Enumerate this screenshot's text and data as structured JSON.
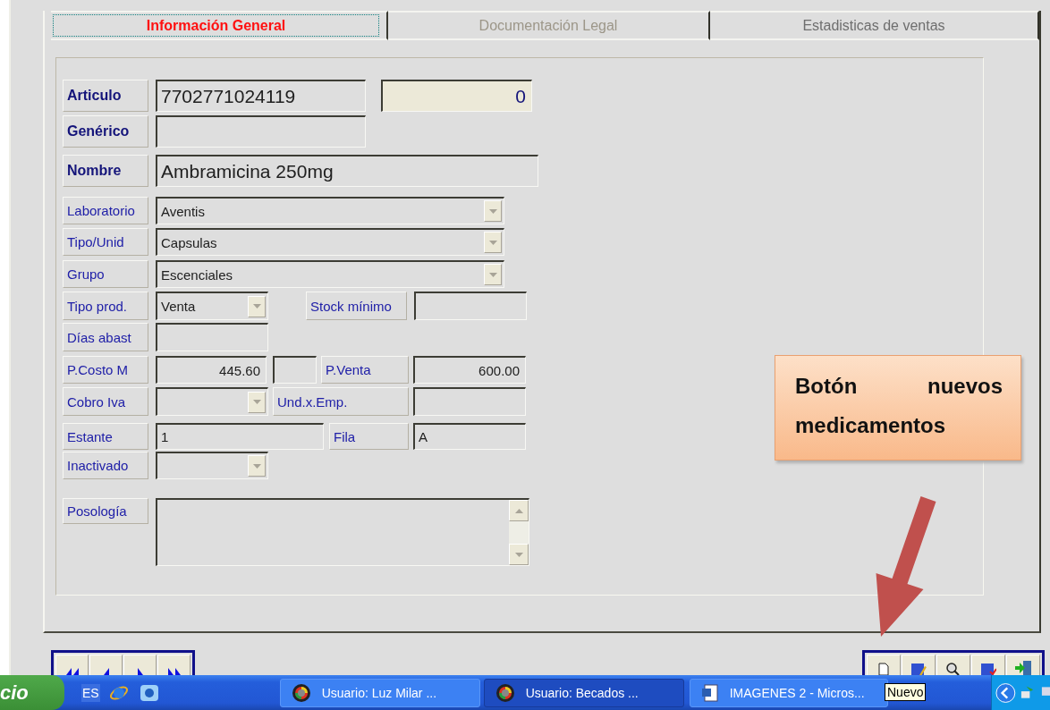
{
  "tabs": [
    {
      "label": "Información General",
      "selected": true,
      "disabled": false
    },
    {
      "label": "Documentación Legal",
      "selected": false,
      "disabled": true
    },
    {
      "label": "Estadisticas de ventas",
      "selected": false,
      "disabled": false
    }
  ],
  "form": {
    "articulo": {
      "label": "Articulo",
      "value": "7702771024119",
      "counter": "0"
    },
    "generico": {
      "label": "Genérico"
    },
    "nombre": {
      "label": "Nombre",
      "value": "Ambramicina 250mg"
    },
    "laboratorio": {
      "label": "Laboratorio",
      "value": "Aventis"
    },
    "tipo_unid": {
      "label": "Tipo/Unid",
      "value": "Capsulas"
    },
    "grupo": {
      "label": "Grupo",
      "value": "Escenciales"
    },
    "tipo_prod": {
      "label": "Tipo prod.",
      "value": "Venta"
    },
    "stock_minimo": {
      "label": "Stock mínimo"
    },
    "dias_abast": {
      "label": "Días abast"
    },
    "p_costo": {
      "label": "P.Costo M",
      "value": "445.60"
    },
    "p_venta": {
      "label": "P.Venta",
      "value": "600.00"
    },
    "cobro_iva": {
      "label": "Cobro Iva"
    },
    "und_emp": {
      "label": "Und.x.Emp."
    },
    "estante": {
      "label": "Estante",
      "value": "1"
    },
    "fila": {
      "label": "Fila",
      "value": "A"
    },
    "inactivado": {
      "label": "Inactivado"
    },
    "posologia": {
      "label": "Posología"
    }
  },
  "callout": {
    "text": "Botón nuevos medicamentos"
  },
  "tooltip": "Nuevo",
  "taskbar": {
    "start": "cio",
    "language": "ES",
    "tasks": [
      {
        "label": "Usuario: Luz Milar ...",
        "kind": "app",
        "selected": false
      },
      {
        "label": "Usuario: Becados  ...",
        "kind": "app",
        "selected": true
      },
      {
        "label": "IMAGENES 2 - Micros...",
        "kind": "word",
        "selected": false
      }
    ]
  }
}
